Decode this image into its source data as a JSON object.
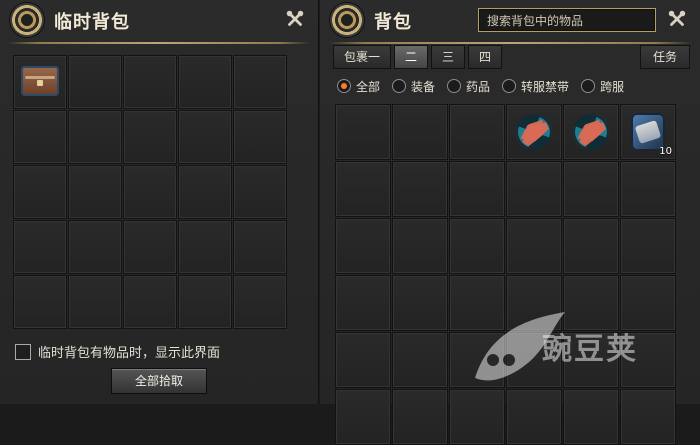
{
  "left_panel": {
    "title": "临时背包",
    "settings_icon": "gear-icon",
    "tools_icon": "tools-icon",
    "checkbox_label": "临时背包有物品时，显示此界面",
    "pickup_button": "全部拾取",
    "grid": {
      "rows": 5,
      "cols": 5,
      "first_item_icon": "chest-icon"
    }
  },
  "right_panel": {
    "title": "背包",
    "search_placeholder": "搜索背包中的物品",
    "tabs": [
      "包裹一",
      "二",
      "三",
      "四"
    ],
    "active_tab_index": 1,
    "task_tab": "任务",
    "filters": [
      "全部",
      "装备",
      "药品",
      "转服禁带",
      "跨服"
    ],
    "selected_filter_index": 0,
    "grid": {
      "rows": 6,
      "cols": 6,
      "items": [
        {
          "index": 3,
          "icon": "shuriken-icon"
        },
        {
          "index": 4,
          "icon": "shuriken-icon"
        },
        {
          "index": 5,
          "icon": "scroll-icon",
          "quantity": "10"
        }
      ]
    }
  },
  "watermark": {
    "text": "豌豆荚",
    "icon": "leaf-icon"
  },
  "colors": {
    "accent_orange": "#ff7b2b",
    "gold": "#d2bd84",
    "panel_bg": "#2b2b2b"
  }
}
